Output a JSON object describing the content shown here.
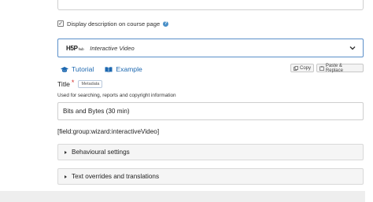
{
  "description_option": {
    "checked": true,
    "label": "Display description on course page",
    "help_icon": "question-circle-icon"
  },
  "library_selector": {
    "logo_text": "H5P",
    "logo_suffix": "hub",
    "selected_library": "Interactive Video",
    "toggle_icon": "chevron-down-icon"
  },
  "links": {
    "tutorial": "Tutorial",
    "example": "Example"
  },
  "actions": {
    "copy": "Copy",
    "paste_replace": "Paste & Replace"
  },
  "title_field": {
    "label": "Title",
    "required_mark": "*",
    "metadata_button": "Metadata",
    "description": "Used for searching, reports and copyright information",
    "value": "Bits and Bytes (30 min)"
  },
  "field_group_placeholder": "[field:group:wizard:interactiveVideo]",
  "groups": [
    {
      "label": "Behavioural settings",
      "expanded": false
    },
    {
      "label": "Text overrides and translations",
      "expanded": false
    }
  ],
  "colors": {
    "link": "#1d68b0",
    "focus_border": "#5a8fc9",
    "required": "#d0312d"
  }
}
